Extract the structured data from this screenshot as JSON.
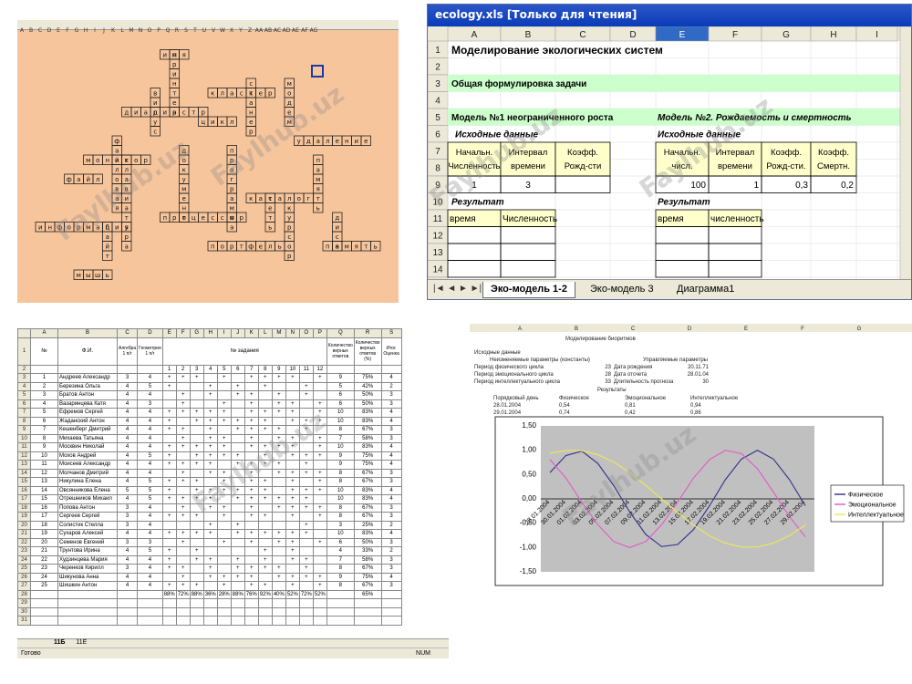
{
  "crossword": {
    "columns": [
      "A",
      "B",
      "C",
      "D",
      "E",
      "F",
      "G",
      "H",
      "I",
      "J",
      "K",
      "L",
      "M",
      "N",
      "O",
      "P",
      "Q",
      "R",
      "S",
      "T",
      "U",
      "V",
      "W",
      "X",
      "Y",
      "Z",
      "AA",
      "AB",
      "AC",
      "AD",
      "AE",
      "AF",
      "AG"
    ],
    "words_horizontal": [
      "кластер",
      "цикл",
      "диадиастр",
      "удаление",
      "монитор",
      "файл",
      "каталог",
      "процессор",
      "информация",
      "портфель",
      "память"
    ],
    "watermark": "Faylhub.uz"
  },
  "ecology": {
    "window_title": "ecology.xls  [Только для чтения]",
    "col_headers": [
      "A",
      "B",
      "C",
      "D",
      "E",
      "F",
      "G",
      "H",
      "I"
    ],
    "row_numbers": [
      "1",
      "2",
      "3",
      "4",
      "5",
      "6",
      "7",
      "8",
      "9",
      "10",
      "11",
      "12",
      "13",
      "14",
      "15"
    ],
    "title": "Моделирование экологических систем",
    "task_label": "Общая формулировка задачи",
    "model1": "Модель №1 неограниченного роста",
    "model2": "Модель №2. Рождаемость и смертность",
    "input1": "Исходные данные",
    "input2": "Исходные данные",
    "m1_headers": [
      "Начальн. Численность",
      "Интервал времени",
      "Коэфф. Рожд-сти"
    ],
    "m1_values": [
      "1",
      "3",
      ""
    ],
    "m2_headers": [
      "Начальн. числ.",
      "Интервал времени",
      "Коэфф. Рожд-сти.",
      "Коэфф. Смертн."
    ],
    "m2_values": [
      "100",
      "1",
      "0,3",
      "0,2"
    ],
    "result1": "Результат",
    "result2": "Результат",
    "res1_cols": [
      "время",
      "Численность"
    ],
    "res2_cols": [
      "время",
      "численность"
    ],
    "tabs": [
      "Эко-модель 1-2",
      "Эко-модель 3",
      "Диаграмма1"
    ]
  },
  "grades": {
    "col_letters": [
      "A",
      "B",
      "C",
      "D",
      "E",
      "F",
      "G",
      "H",
      "I",
      "J",
      "K",
      "L",
      "M",
      "N",
      "O",
      "P",
      "Q",
      "R",
      "S"
    ],
    "header_no": "№",
    "header_fio": "Ф.И.",
    "header_alg": "Алгебра 1 п/г",
    "header_geo": "Геометрия 1 п/г",
    "header_tasks": "№ задания",
    "header_correct": "Количество верных ответов",
    "header_pct": "Количество верных ответов (%)",
    "header_mark": "Итог. Оценка",
    "task_nums": [
      "1",
      "2",
      "3",
      "4",
      "5",
      "6",
      "7",
      "8",
      "9",
      "10",
      "11",
      "12"
    ],
    "students": [
      {
        "n": "1",
        "fio": "Андреев Александр",
        "a": "3",
        "g": "4",
        "c": "9",
        "p": "75%",
        "m": "4"
      },
      {
        "n": "2",
        "fio": "Березина Ольга",
        "a": "4",
        "g": "5",
        "c": "5",
        "p": "42%",
        "m": "2"
      },
      {
        "n": "3",
        "fio": "Братов Антон",
        "a": "4",
        "g": "4",
        "c": "6",
        "p": "50%",
        "m": "3"
      },
      {
        "n": "4",
        "fio": "Вазаринцева Катя",
        "a": "4",
        "g": "3",
        "c": "6",
        "p": "50%",
        "m": "3"
      },
      {
        "n": "5",
        "fio": "Ефремов Сергей",
        "a": "4",
        "g": "4",
        "c": "10",
        "p": "83%",
        "m": "4"
      },
      {
        "n": "6",
        "fio": "Жаданский Антон",
        "a": "4",
        "g": "4",
        "c": "10",
        "p": "83%",
        "m": "4"
      },
      {
        "n": "7",
        "fio": "Кешенберг Дмитрий",
        "a": "4",
        "g": "4",
        "c": "8",
        "p": "67%",
        "m": "3"
      },
      {
        "n": "8",
        "fio": "Михаева Татьяна",
        "a": "4",
        "g": "4",
        "c": "7",
        "p": "58%",
        "m": "3"
      },
      {
        "n": "9",
        "fio": "Москвин Николай",
        "a": "4",
        "g": "4",
        "c": "10",
        "p": "83%",
        "m": "4"
      },
      {
        "n": "10",
        "fio": "Мохов Андрей",
        "a": "4",
        "g": "5",
        "c": "9",
        "p": "75%",
        "m": "4"
      },
      {
        "n": "11",
        "fio": "Моисеев Александр",
        "a": "4",
        "g": "4",
        "c": "9",
        "p": "75%",
        "m": "4"
      },
      {
        "n": "12",
        "fio": "Молчанов Дмитрий",
        "a": "4",
        "g": "4",
        "c": "8",
        "p": "67%",
        "m": "3"
      },
      {
        "n": "13",
        "fio": "Никулина Елена",
        "a": "4",
        "g": "5",
        "c": "8",
        "p": "67%",
        "m": "3"
      },
      {
        "n": "14",
        "fio": "Овсянникова Елена",
        "a": "5",
        "g": "5",
        "c": "10",
        "p": "83%",
        "m": "4"
      },
      {
        "n": "15",
        "fio": "Отрешников Михаил",
        "a": "4",
        "g": "5",
        "c": "10",
        "p": "83%",
        "m": "4"
      },
      {
        "n": "16",
        "fio": "Попова Антон",
        "a": "3",
        "g": "4",
        "c": "8",
        "p": "67%",
        "m": "3"
      },
      {
        "n": "17",
        "fio": "Сергеев Сергей",
        "a": "3",
        "g": "4",
        "c": "8",
        "p": "67%",
        "m": "3"
      },
      {
        "n": "18",
        "fio": "Солистик Стелла",
        "a": "3",
        "g": "4",
        "c": "3",
        "p": "25%",
        "m": "2"
      },
      {
        "n": "19",
        "fio": "Сухаров Алексей",
        "a": "4",
        "g": "4",
        "c": "10",
        "p": "83%",
        "m": "4"
      },
      {
        "n": "20",
        "fio": "Семенов Евгений",
        "a": "3",
        "g": "3",
        "c": "6",
        "p": "50%",
        "m": "3"
      },
      {
        "n": "21",
        "fio": "Трунтова Ирина",
        "a": "4",
        "g": "5",
        "c": "4",
        "p": "33%",
        "m": "2"
      },
      {
        "n": "22",
        "fio": "Худзинцева Мария",
        "a": "4",
        "g": "4",
        "c": "7",
        "p": "58%",
        "m": "3"
      },
      {
        "n": "23",
        "fio": "Черенков Кирилл",
        "a": "3",
        "g": "4",
        "c": "8",
        "p": "67%",
        "m": "3"
      },
      {
        "n": "24",
        "fio": "Шикунова Анна",
        "a": "4",
        "g": "4",
        "c": "9",
        "p": "75%",
        "m": "4"
      },
      {
        "n": "25",
        "fio": "Шишкин Антон",
        "a": "4",
        "g": "4",
        "c": "8",
        "p": "67%",
        "m": "3"
      }
    ],
    "task_pct": [
      "88%",
      "72%",
      "88%",
      "36%",
      "28%",
      "88%",
      "76%",
      "92%",
      "40%",
      "52%",
      "72%",
      "52%"
    ],
    "total_pct": "65%",
    "sheet_tabs": [
      "11Б",
      "11Е"
    ],
    "status_left": "Готово",
    "status_right": "NUM"
  },
  "biorhythm": {
    "title": "Моделирование биоритмов",
    "input_label": "Исходные данные",
    "fixed_label": "Неизменяемые параметры (константы)",
    "var_label": "Управляемые параметры",
    "params": [
      {
        "name": "Период физического цикла",
        "val": "23",
        "name2": "Дата рождения",
        "val2": "20.11.71"
      },
      {
        "name": "Период эмоционального цикла",
        "val": "28",
        "name2": "Дата отсчета",
        "val2": "28.01.04"
      },
      {
        "name": "Период интеллектуального цикла",
        "val": "33",
        "name2": "Длительность прогноза",
        "val2": "30"
      }
    ],
    "results_label": "Результаты",
    "res_cols": [
      "Порядковый день",
      "Физическое",
      "Эмоциональное",
      "Интеллектуальное"
    ],
    "res_rows": [
      [
        "28.01.2004",
        "0,54",
        "0,81",
        "0,94"
      ],
      [
        "29.01.2004",
        "0,74",
        "0,42",
        "0,86"
      ]
    ]
  },
  "chart_data": {
    "type": "line",
    "title": "",
    "xlabel": "",
    "ylabel": "",
    "ylim": [
      -1.5,
      1.5
    ],
    "yticks": [
      "1,50",
      "1,00",
      "0,50",
      "0,00",
      "-0,50",
      "-1,00",
      "-1,50"
    ],
    "x": [
      "28.01.2004",
      "30.01.2004",
      "01.02.2004",
      "03.02.2004",
      "05.02.2004",
      "07.02.2004",
      "09.02.2004",
      "11.02.2004",
      "13.02.2004",
      "15.02.2004",
      "17.02.2004",
      "19.02.2004",
      "21.02.2004",
      "23.02.2004",
      "25.02.2004",
      "27.02.2004",
      "29.02.2004"
    ],
    "series": [
      {
        "name": "Физическое",
        "color": "#3b3b8f",
        "values": [
          0.54,
          0.89,
          0.98,
          0.73,
          0.27,
          -0.27,
          -0.73,
          -0.98,
          -0.94,
          -0.63,
          -0.14,
          0.4,
          0.82,
          1.0,
          0.82,
          0.4,
          -0.14
        ]
      },
      {
        "name": "Эмоциональное",
        "color": "#e060c8",
        "values": [
          0.81,
          0.43,
          -0.07,
          -0.53,
          -0.88,
          -1.0,
          -0.88,
          -0.53,
          -0.07,
          0.43,
          0.81,
          1.0,
          0.93,
          0.62,
          0.14,
          -0.36,
          -0.78
        ]
      },
      {
        "name": "Интеллектуальное",
        "color": "#e8e85a",
        "values": [
          0.94,
          0.99,
          0.99,
          0.91,
          0.76,
          0.54,
          0.28,
          0.0,
          -0.28,
          -0.54,
          -0.76,
          -0.91,
          -0.99,
          -0.99,
          -0.91,
          -0.76,
          -0.54
        ]
      }
    ],
    "legend_position": "right",
    "grid": false
  },
  "watermark": "Faylhub.uz"
}
